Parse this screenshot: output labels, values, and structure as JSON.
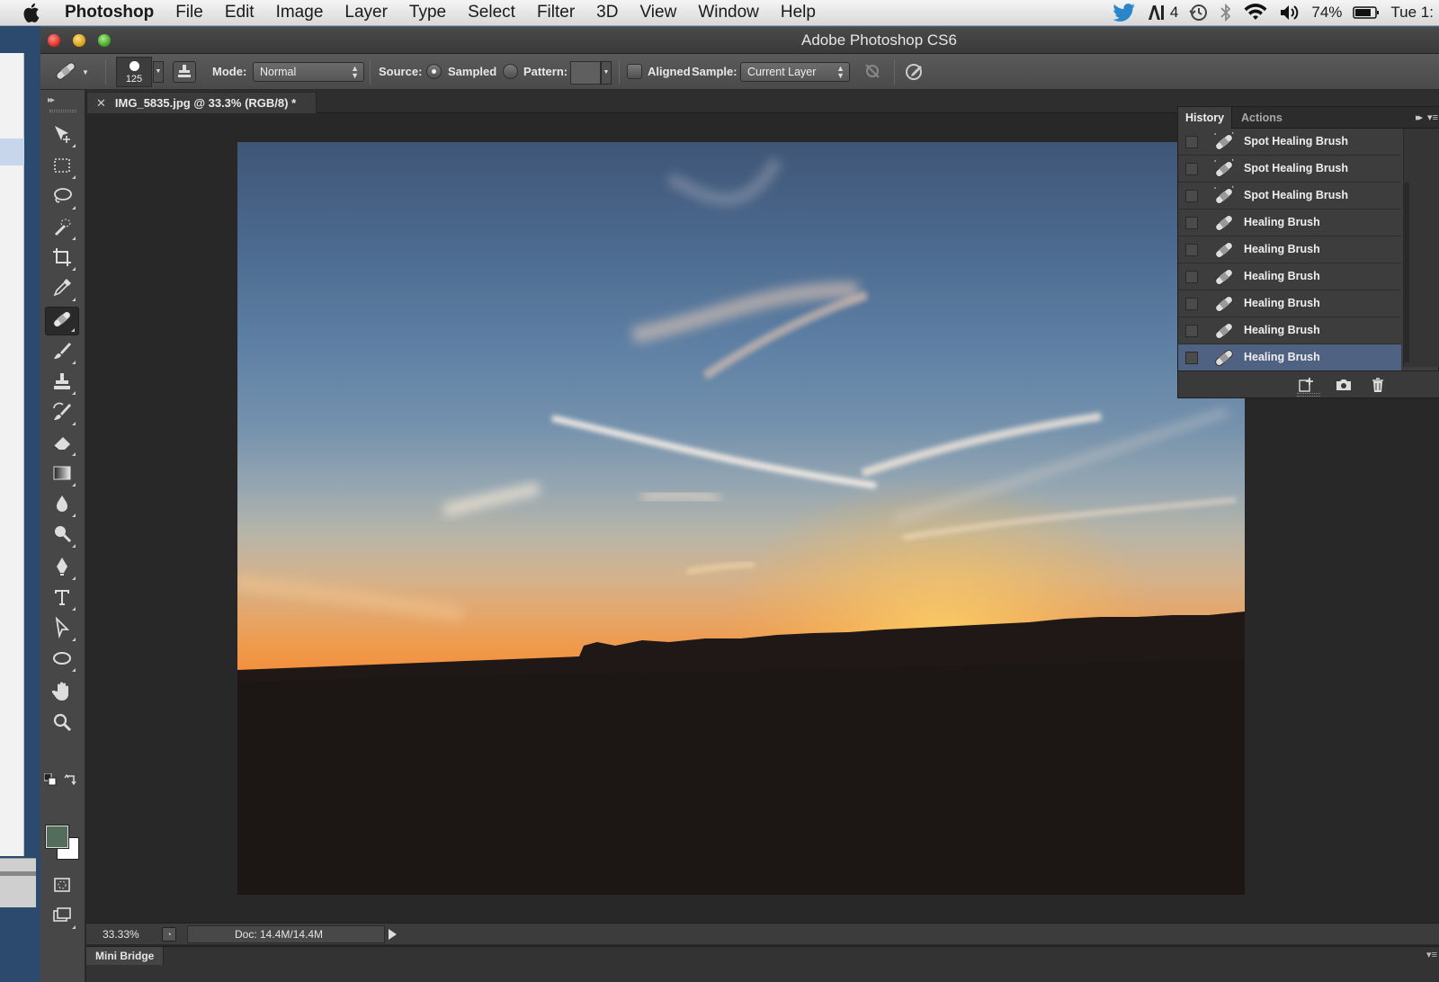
{
  "menubar": {
    "app_name": "Photoshop",
    "items": [
      "File",
      "Edit",
      "Image",
      "Layer",
      "Type",
      "Select",
      "Filter",
      "3D",
      "View",
      "Window",
      "Help"
    ],
    "status": {
      "notifications": "4",
      "battery": "74%",
      "clock": "Tue 1:"
    }
  },
  "window": {
    "title": "Adobe Photoshop CS6"
  },
  "options_bar": {
    "brush_size": "125",
    "mode_label": "Mode:",
    "mode_value": "Normal",
    "source_label": "Source:",
    "sampled_label": "Sampled",
    "source_selected": "Sampled",
    "pattern_label": "Pattern:",
    "aligned_label": "Aligned",
    "aligned_checked": false,
    "sample_label": "Sample:",
    "sample_value": "Current Layer"
  },
  "toolbox": {
    "active_tool": "healing-brush",
    "foreground_color": "#546c5c",
    "background_color": "#ffffff"
  },
  "document": {
    "tab_title": "IMG_5835.jpg @ 33.3% (RGB/8) *",
    "zoom": "33.33%",
    "doc_info": "Doc: 14.4M/14.4M"
  },
  "history_panel": {
    "tabs": [
      "History",
      "Actions"
    ],
    "active_tab": "History",
    "items": [
      {
        "label": "Spot Healing Brush",
        "icon": "spot-healing-brush-icon",
        "current": false
      },
      {
        "label": "Spot Healing Brush",
        "icon": "spot-healing-brush-icon",
        "current": false
      },
      {
        "label": "Spot Healing Brush",
        "icon": "spot-healing-brush-icon",
        "current": false
      },
      {
        "label": "Healing Brush",
        "icon": "healing-brush-icon",
        "current": false
      },
      {
        "label": "Healing Brush",
        "icon": "healing-brush-icon",
        "current": false
      },
      {
        "label": "Healing Brush",
        "icon": "healing-brush-icon",
        "current": false
      },
      {
        "label": "Healing Brush",
        "icon": "healing-brush-icon",
        "current": false
      },
      {
        "label": "Healing Brush",
        "icon": "healing-brush-icon",
        "current": false
      },
      {
        "label": "Healing Brush",
        "icon": "healing-brush-icon",
        "current": true
      }
    ]
  },
  "bottom_panel": {
    "mini_bridge_label": "Mini Bridge"
  },
  "colors": {
    "history_selected": "#4f6281",
    "panel_bg": "#3d3d3d"
  }
}
